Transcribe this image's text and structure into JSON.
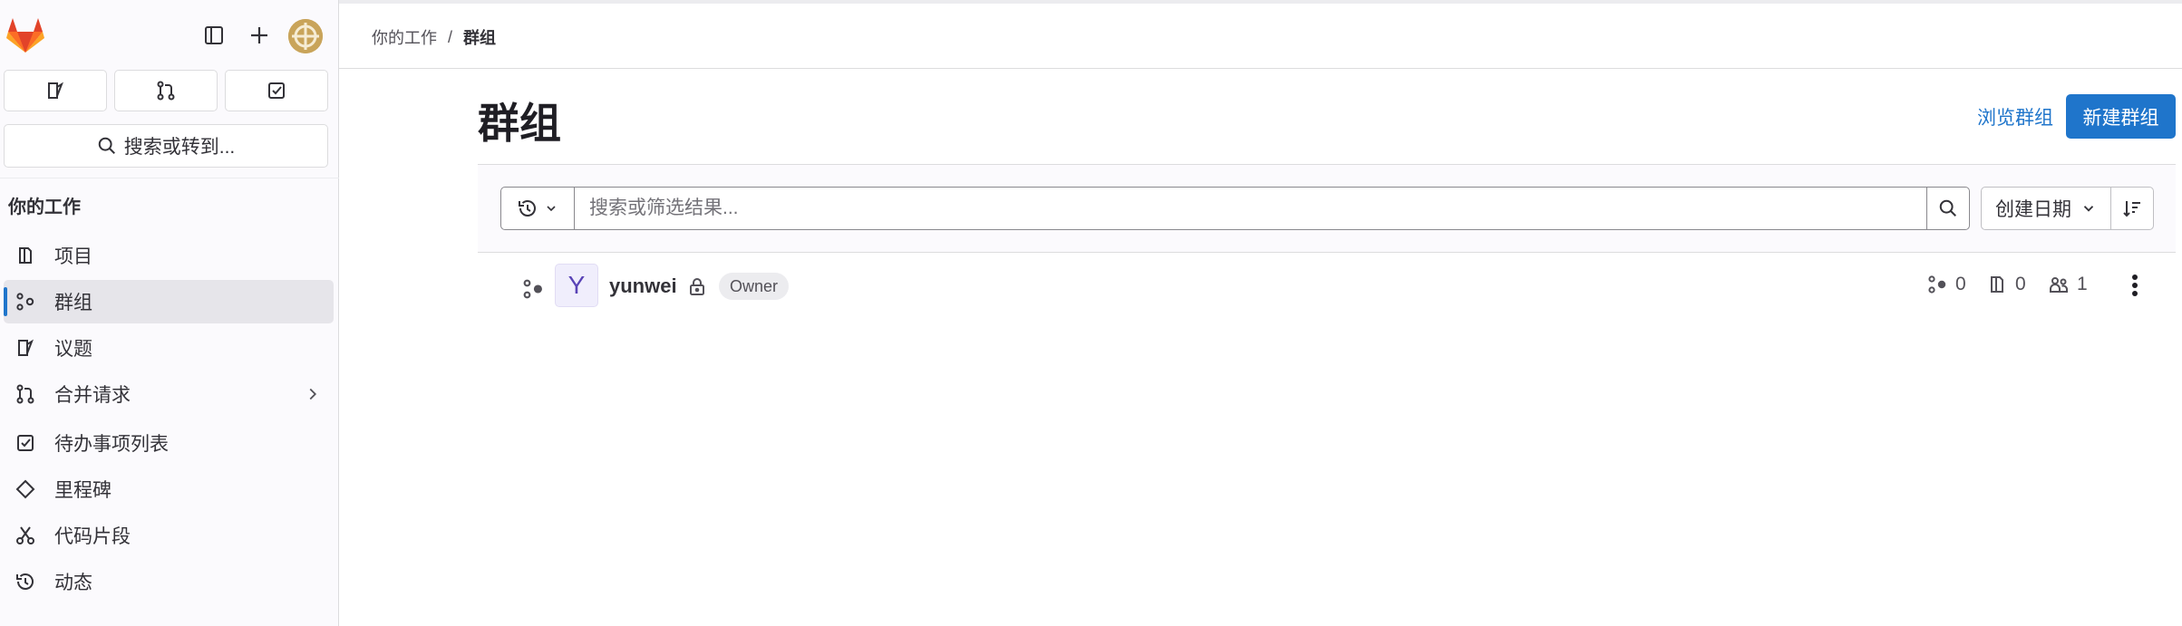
{
  "sidebar": {
    "search_label": "搜索或转到...",
    "section_heading": "你的工作",
    "items": [
      {
        "label": "项目",
        "icon": "project-icon"
      },
      {
        "label": "群组",
        "icon": "group-icon",
        "active": true
      },
      {
        "label": "议题",
        "icon": "issues-icon"
      },
      {
        "label": "合并请求",
        "icon": "merge-request-icon",
        "has_chevron": true
      },
      {
        "label": "待办事项列表",
        "icon": "todo-icon"
      },
      {
        "label": "里程碑",
        "icon": "milestone-icon"
      },
      {
        "label": "代码片段",
        "icon": "snippet-icon"
      },
      {
        "label": "动态",
        "icon": "activity-icon"
      }
    ]
  },
  "breadcrumb": {
    "parent": "你的工作",
    "separator": "/",
    "current": "群组"
  },
  "page": {
    "title": "群组",
    "explore_link": "浏览群组",
    "new_group_button": "新建群组"
  },
  "filter": {
    "placeholder": "搜索或筛选结果...",
    "sort_label": "创建日期"
  },
  "groups": [
    {
      "avatar_letter": "Y",
      "name": "yunwei",
      "visibility": "private",
      "role": "Owner",
      "subgroups": "0",
      "projects": "0",
      "members": "1"
    }
  ],
  "colors": {
    "accent": "#1f75cb",
    "sidebar_bg": "#fbfafd",
    "avatar_bg": "#f0eefc"
  }
}
